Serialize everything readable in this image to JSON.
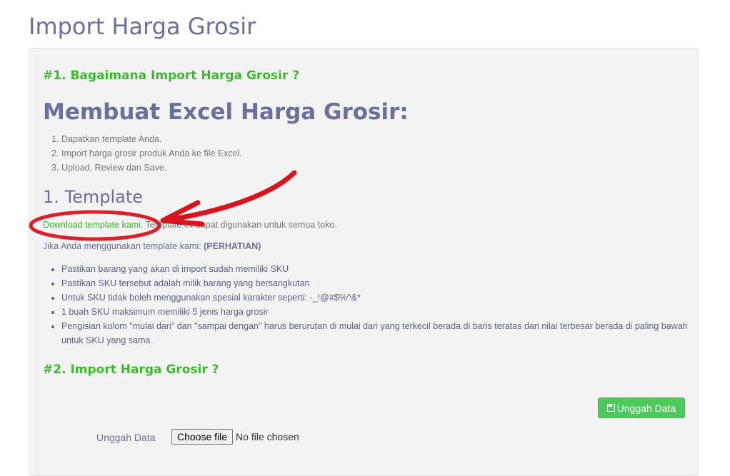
{
  "page": {
    "title": "Import Harga Grosir"
  },
  "section1": {
    "heading": "#1. Bagaimana Import Harga Grosir ?",
    "title": "Membuat Excel Harga Grosir:",
    "steps": [
      "Dapatkan template Anda.",
      "Import harga grosir produk Anda ke file Excel.",
      "Upload, Review dan Save."
    ],
    "template_heading": "1. Template",
    "download_link": "Download template kami",
    "download_suffix": ". Template ini dapat digunakan untuk semua toko.",
    "notice_prefix": "Jika Anda menggunakan template kami: ",
    "notice_bold": "(PERHATIAN)",
    "rules": [
      "Pastikan barang yang akan di import sudah memiliki SKU",
      "Pastikan SKU tersebut adalah milik barang yang bersangkutan",
      "Untuk SKU tidak boleh menggunakan spesial karakter seperti: -_!@#$%^&*",
      "1 buah SKU maksimum memiliki 5 jenis harga grosir",
      "Pengisian kolom \"mulai dari\" dan \"sampai dengan\" harus berurutan di mulai dari yang terkecil berada di baris teratas dan nilai terbesar berada di paling bawah untuk SKU yang sama"
    ]
  },
  "section2": {
    "heading": "#2. Import Harga Grosir ?",
    "upload_button": "Unggah Data",
    "upload_label": "Unggah Data",
    "choose_file": "Choose file",
    "no_file": "No file chosen"
  },
  "colors": {
    "title": "#6b6f9c",
    "green": "#3dbb2e",
    "button": "#4cc95b",
    "annotation": "#d8141c"
  },
  "icons": {
    "upload_button_icon": "floppy-disk-icon"
  }
}
